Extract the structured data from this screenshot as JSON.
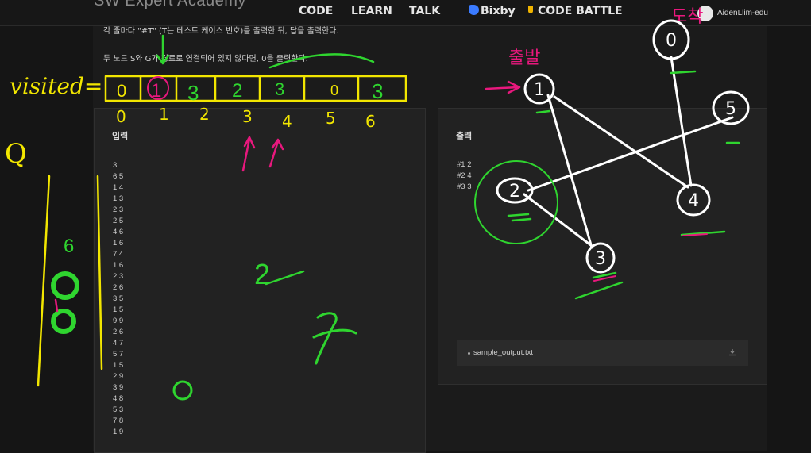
{
  "header": {
    "brand": "SW Expert Academy",
    "nav": [
      "CODE",
      "LEARN",
      "TALK",
      "Bixby",
      "CODE BATTLE"
    ],
    "username": "AidenLlim-edu"
  },
  "description": {
    "line1": "각 줄마다 \"#T\" (T는 테스트 케이스 번호)를 출력한 뒤, 답을 출력한다.",
    "line2": "두 노드 S와 G가 경로로 연결되어 있지 않다면, 0을 출력한다."
  },
  "input_panel": {
    "title": "입력",
    "lines": [
      "3",
      "6 5",
      "1 4",
      "1 3",
      "2 3",
      "2 5",
      "4 6",
      "1 6",
      "7 4",
      "1 6",
      "2 3",
      "2 6",
      "3 5",
      "1 5",
      "9 9",
      "2 6",
      "4 7",
      "5 7",
      "1 5",
      "2 9",
      "3 9",
      "4 8",
      "5 3",
      "7 8",
      "1 9"
    ]
  },
  "output_panel": {
    "title": "출력",
    "lines": [
      "#1 2",
      "#2 4",
      "#3 3"
    ],
    "file_name": "sample_output.txt"
  },
  "annotations": {
    "visited_label": "visited=",
    "visited_cells": [
      "0",
      "1",
      "3",
      "2",
      "3",
      "0",
      "3"
    ],
    "visited_indices": [
      "0",
      "1",
      "2",
      "3",
      "4",
      "5",
      "6"
    ],
    "queue_label": "Q",
    "queue_top": "6",
    "start_label": "출발",
    "end_label": "도착",
    "graph_nodes": [
      "0",
      "1",
      "5",
      "2",
      "4",
      "3"
    ],
    "scribble_two": "2",
    "colors": {
      "yellow": "#f2e600",
      "green": "#2fd52f",
      "magenta": "#e8187d",
      "white": "#ffffff"
    }
  }
}
